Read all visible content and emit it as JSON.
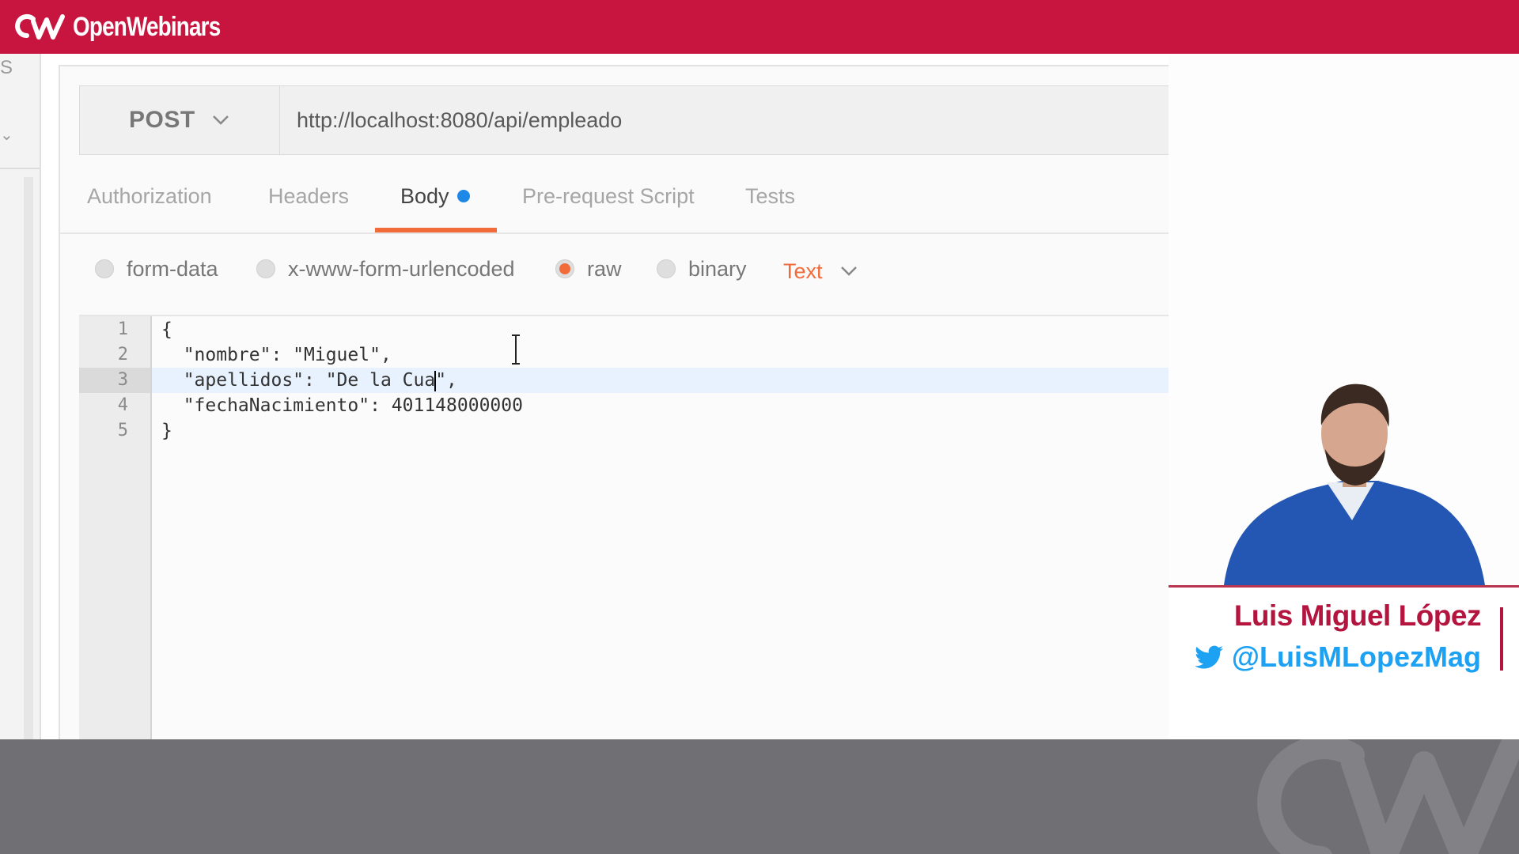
{
  "brand": {
    "name": "OpenWebinars",
    "logo_icon": "ow-logo-icon"
  },
  "request": {
    "method": "POST",
    "url": "http://localhost:8080/api/empleado"
  },
  "tabs": [
    {
      "label": "Authorization",
      "active": false
    },
    {
      "label": "Headers",
      "active": false
    },
    {
      "label": "Body",
      "active": true,
      "dot_color": "#1e88e5"
    },
    {
      "label": "Pre-request Script",
      "active": false
    },
    {
      "label": "Tests",
      "active": false
    }
  ],
  "body_types": [
    {
      "label": "form-data",
      "checked": false
    },
    {
      "label": "x-www-form-urlencoded",
      "checked": false
    },
    {
      "label": "raw",
      "checked": true
    },
    {
      "label": "binary",
      "checked": false
    }
  ],
  "format_dropdown": {
    "value": "Text"
  },
  "editor": {
    "lines": [
      {
        "number": "1",
        "text": "{"
      },
      {
        "number": "2",
        "text": "  \"nombre\": \"Miguel\","
      },
      {
        "number": "3",
        "before_caret": "  \"apellidos\": \"De la Cua",
        "after_caret": "\","
      },
      {
        "number": "4",
        "text": "  \"fechaNacimiento\": 401148000000"
      },
      {
        "number": "5",
        "text": "}"
      }
    ],
    "highlighted_line": 3
  },
  "presenter": {
    "name": "Luis Miguel López",
    "handle": "@LuisMLopezMag",
    "handle_icon": "twitter-bird-icon"
  },
  "sidebar": {
    "fragment_text": "S"
  },
  "colors": {
    "brand": "#c8153f",
    "accent": "#f26b3a",
    "twitter": "#1da1f2",
    "footer": "#707074"
  }
}
